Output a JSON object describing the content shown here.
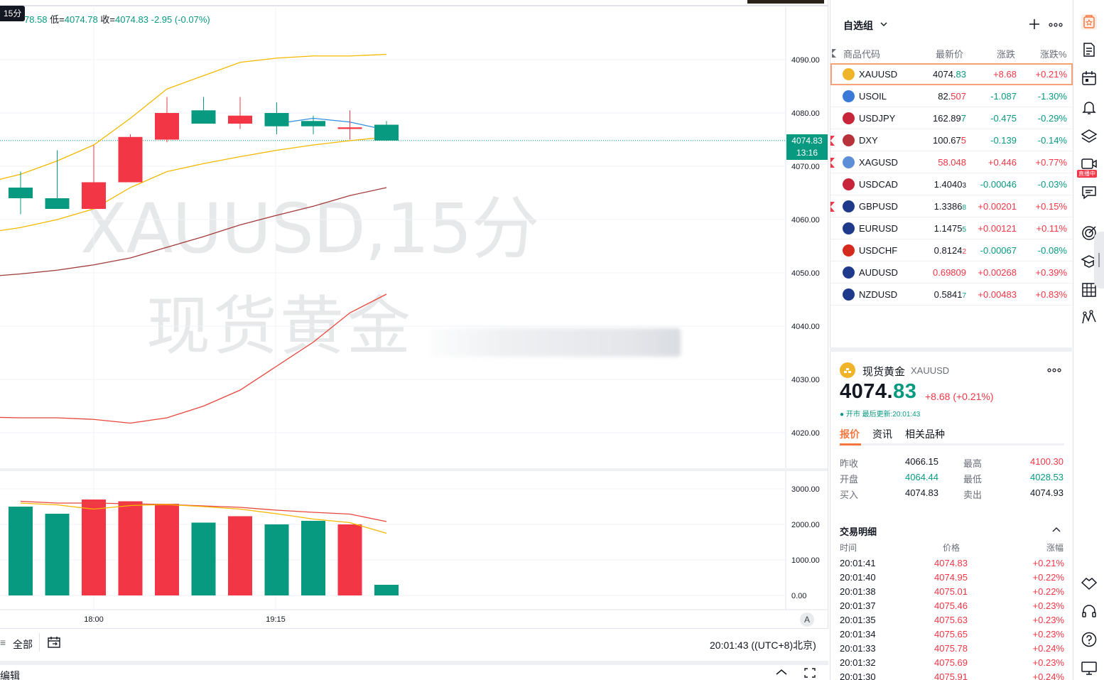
{
  "chart": {
    "interval_badge": "15分",
    "ohlc": {
      "high_partial": "78.58",
      "low_label": "低=",
      "low": "4074.78",
      "close_label": "收=",
      "close": "4074.83",
      "change": "-2.95",
      "change_pct": "(-0.07%)"
    },
    "watermark_symbol": "XAUUSD,15分",
    "watermark_name": "现货黄金",
    "current_price_tag": "4074.83",
    "countdown": "13:16",
    "price_axis": [
      "4090.00",
      "4080.00",
      "4070.00",
      "4060.00",
      "4050.00",
      "4040.00",
      "4030.00",
      "4020.00"
    ],
    "volume_axis": [
      "3000.00",
      "2000.00",
      "1000.00",
      "0.00"
    ],
    "time_axis": [
      "18:00",
      "19:15"
    ],
    "auto_scale_label": "A"
  },
  "chart_data": {
    "type": "candlestick",
    "ylim": [
      4015,
      4098
    ],
    "candles": [
      {
        "o": 4066.0,
        "h": 4069.0,
        "l": 4061.0,
        "c": 4064.0,
        "dir": "down"
      },
      {
        "o": 4064.0,
        "h": 4073.0,
        "l": 4062.0,
        "c": 4062.0,
        "dir": "down"
      },
      {
        "o": 4062.0,
        "h": 4074.0,
        "l": 4062.0,
        "c": 4067.0,
        "dir": "up"
      },
      {
        "o": 4067.0,
        "h": 4076.0,
        "l": 4068.0,
        "c": 4075.5,
        "dir": "up"
      },
      {
        "o": 4075.0,
        "h": 4083.0,
        "l": 4074.5,
        "c": 4080.0,
        "dir": "up"
      },
      {
        "o": 4080.5,
        "h": 4083.0,
        "l": 4078.0,
        "c": 4078.0,
        "dir": "down"
      },
      {
        "o": 4078.0,
        "h": 4083.0,
        "l": 4077.0,
        "c": 4079.5,
        "dir": "up"
      },
      {
        "o": 4080.0,
        "h": 4082.0,
        "l": 4076.0,
        "c": 4077.5,
        "dir": "down"
      },
      {
        "o": 4078.5,
        "h": 4079.5,
        "l": 4076.0,
        "c": 4077.5,
        "dir": "down"
      },
      {
        "o": 4077.3,
        "h": 4080.5,
        "l": 4075.0,
        "c": 4077.0,
        "dir": "up"
      },
      {
        "o": 4077.8,
        "h": 4078.5,
        "l": 4074.78,
        "c": 4074.83,
        "dir": "down"
      }
    ],
    "ma_blue": [
      [
        7,
        4078.0
      ],
      [
        8,
        4079.0
      ],
      [
        9,
        4078.3
      ],
      [
        10,
        4076.8
      ]
    ],
    "bb_upper": [
      [
        -1.5,
        4066.0
      ],
      [
        0,
        4068.5
      ],
      [
        1,
        4071.0
      ],
      [
        2,
        4074.0
      ],
      [
        3,
        4079.0
      ],
      [
        4,
        4084.5
      ],
      [
        5,
        4087.0
      ],
      [
        6,
        4089.5
      ],
      [
        7,
        4090.3
      ],
      [
        8,
        4090.7
      ],
      [
        9,
        4090.7
      ],
      [
        10,
        4091.0
      ]
    ],
    "bb_middle": [
      [
        -1.5,
        4057.0
      ],
      [
        0,
        4058.5
      ],
      [
        1,
        4060.0
      ],
      [
        2,
        4062.0
      ],
      [
        3,
        4066.0
      ],
      [
        4,
        4069.0
      ],
      [
        5,
        4070.5
      ],
      [
        6,
        4071.8
      ],
      [
        7,
        4073.0
      ],
      [
        8,
        4074.0
      ],
      [
        9,
        4074.8
      ],
      [
        10,
        4075.5
      ]
    ],
    "ma_dark": [
      [
        -1.5,
        4049.0
      ],
      [
        0,
        4049.8
      ],
      [
        1,
        4050.5
      ],
      [
        2,
        4051.5
      ],
      [
        3,
        4052.8
      ],
      [
        4,
        4054.8
      ],
      [
        5,
        4056.8
      ],
      [
        6,
        4059.0
      ],
      [
        7,
        4060.8
      ],
      [
        8,
        4062.5
      ],
      [
        9,
        4064.5
      ],
      [
        10,
        4066.0
      ]
    ],
    "bb_lower": [
      [
        -1.5,
        4023.0
      ],
      [
        0,
        4022.8
      ],
      [
        1,
        4022.8
      ],
      [
        2,
        4022.5
      ],
      [
        3,
        4021.8
      ],
      [
        4,
        4022.8
      ],
      [
        5,
        4025.0
      ],
      [
        6,
        4028.0
      ],
      [
        7,
        4032.5
      ],
      [
        8,
        4037.0
      ],
      [
        9,
        4042.5
      ],
      [
        10,
        4046.0
      ]
    ],
    "volumes": [
      2500,
      2300,
      2700,
      2650,
      2580,
      2050,
      2230,
      2000,
      2100,
      2000,
      300
    ],
    "vol_dir": [
      "down",
      "down",
      "up",
      "up",
      "up",
      "down",
      "up",
      "down",
      "down",
      "up",
      "down"
    ],
    "vol_ma_red": [
      2650,
      2600,
      2600,
      2580,
      2560,
      2520,
      2480,
      2400,
      2340,
      2290,
      2080
    ],
    "vol_ma_orange": [
      2600,
      2550,
      2430,
      2530,
      2560,
      2500,
      2430,
      2300,
      2150,
      2050,
      1750
    ],
    "vol_ylim": [
      0,
      3000
    ]
  },
  "watchlist": {
    "title": "自选组",
    "col_symbol": "商品代码",
    "col_last": "最新价",
    "col_change": "涨跌",
    "col_pct": "涨跌%",
    "rows": [
      {
        "symbol": "XAUUSD",
        "last_main": "4074.",
        "last_tail": "83",
        "tail_dir": "down",
        "change": "+8.68",
        "pct": "+0.21%",
        "dir": "up",
        "flag": false,
        "icon_color": "#f0b429"
      },
      {
        "symbol": "USOIL",
        "last_main": "82.",
        "last_tail": "507",
        "tail_dir": "up",
        "change": "-1.087",
        "pct": "-1.30%",
        "dir": "down",
        "flag": false,
        "icon_color": "#3a79d8"
      },
      {
        "symbol": "USDJPY",
        "last_main": "162.89",
        "last_tail": "7",
        "tail_dir": "down",
        "change": "-0.475",
        "pct": "-0.29%",
        "dir": "down",
        "flag": false,
        "icon_color": "#c8243a"
      },
      {
        "symbol": "DXY",
        "last_main": "100.67",
        "last_tail": "5",
        "tail_dir": "up",
        "change": "-0.139",
        "pct": "-0.14%",
        "dir": "down",
        "flag": true,
        "icon_color": "#b8323c"
      },
      {
        "symbol": "XAGUSD",
        "last_main": "",
        "last_tail": "58.048",
        "tail_dir": "up",
        "change": "+0.446",
        "pct": "+0.77%",
        "dir": "up",
        "flag": true,
        "icon_color": "#5d8fd8"
      },
      {
        "symbol": "USDCAD",
        "last_main": "1.4040",
        "last_tail": "3",
        "tail_dir": "neutral",
        "change": "-0.00046",
        "pct": "-0.03%",
        "dir": "down",
        "flag": false,
        "icon_color": "#c8243a"
      },
      {
        "symbol": "GBPUSD",
        "last_main": "1.3386",
        "last_tail": "8",
        "tail_dir": "down",
        "change": "+0.00201",
        "pct": "+0.15%",
        "dir": "up",
        "flag": true,
        "icon_color": "#1f3a8a"
      },
      {
        "symbol": "EURUSD",
        "last_main": "1.1475",
        "last_tail": "5",
        "tail_dir": "down",
        "change": "+0.00121",
        "pct": "+0.11%",
        "dir": "up",
        "flag": false,
        "icon_color": "#1f3a8a"
      },
      {
        "symbol": "USDCHF",
        "last_main": "0.8124",
        "last_tail": "2",
        "tail_dir": "up",
        "change": "-0.00067",
        "pct": "-0.08%",
        "dir": "down",
        "flag": false,
        "icon_color": "#d52b1e"
      },
      {
        "symbol": "AUDUSD",
        "last_main": "",
        "last_tail": "0.69809",
        "tail_dir": "up",
        "change": "+0.00268",
        "pct": "+0.39%",
        "dir": "up",
        "flag": false,
        "icon_color": "#1f3a8a"
      },
      {
        "symbol": "NZDUSD",
        "last_main": "0.5841",
        "last_tail": "7",
        "tail_dir": "down",
        "change": "+0.00483",
        "pct": "+0.83%",
        "dir": "up",
        "flag": false,
        "icon_color": "#1f3a8a"
      }
    ]
  },
  "details": {
    "name": "现货黄金",
    "code": "XAUUSD",
    "price_main": "4074.",
    "price_dec": "83",
    "change": "+8.68 (+0.21%)",
    "status": "● 开市 最后更新:20:01:43",
    "tabs": [
      "报价",
      "资讯",
      "相关品种"
    ],
    "stats": {
      "prev_close_label": "昨收",
      "prev_close": "4066.15",
      "high_label": "最高",
      "high": "4100.30",
      "open_label": "开盘",
      "open": "4064.44",
      "low_label": "最低",
      "low": "4028.53",
      "bid_label": "买入",
      "bid": "4074.83",
      "ask_label": "卖出",
      "ask": "4074.93"
    },
    "trades_title": "交易明细",
    "trades_cols": [
      "时间",
      "价格",
      "涨幅"
    ],
    "trades": [
      {
        "time": "20:01:41",
        "price": "4074.83",
        "pct": "+0.21%"
      },
      {
        "time": "20:01:40",
        "price": "4074.95",
        "pct": "+0.22%"
      },
      {
        "time": "20:01:38",
        "price": "4075.01",
        "pct": "+0.22%"
      },
      {
        "time": "20:01:37",
        "price": "4075.46",
        "pct": "+0.23%"
      },
      {
        "time": "20:01:35",
        "price": "4075.63",
        "pct": "+0.23%"
      },
      {
        "time": "20:01:34",
        "price": "4075.65",
        "pct": "+0.23%"
      },
      {
        "time": "20:01:33",
        "price": "4075.78",
        "pct": "+0.24%"
      },
      {
        "time": "20:01:32",
        "price": "4075.69",
        "pct": "+0.23%"
      },
      {
        "time": "20:01:30",
        "price": "4075.91",
        "pct": "+0.24%"
      }
    ]
  },
  "toolbar": {
    "range_all": "全部",
    "clock": "20:01:43 ((UTC+8)北京)",
    "editor_label": "编辑"
  },
  "iconbar": {
    "live_badge": "直播中"
  },
  "colors": {
    "up": "#f23645",
    "down": "#089981",
    "accent": "#f7763e"
  }
}
